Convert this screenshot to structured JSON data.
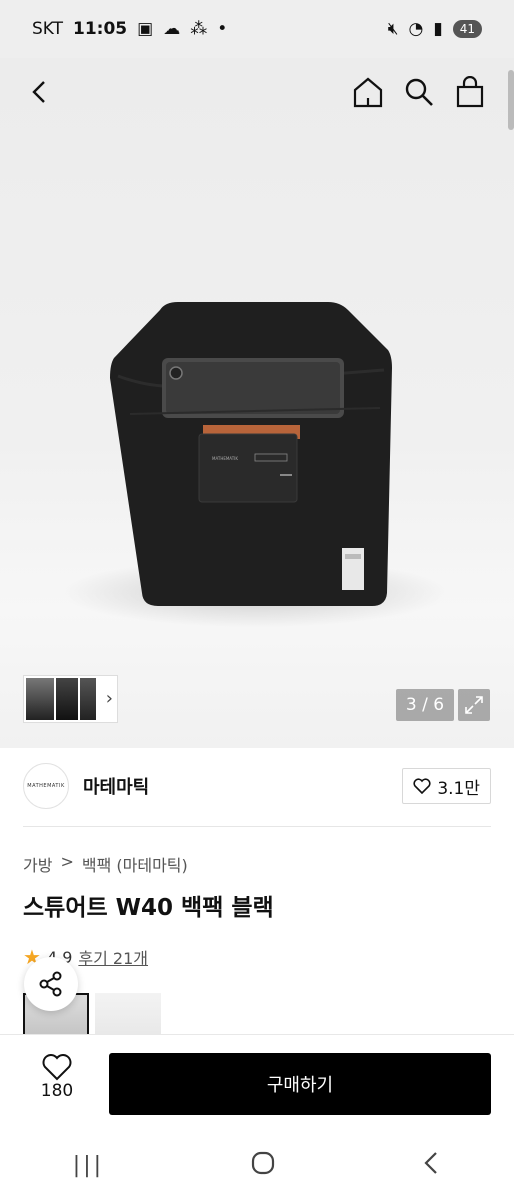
{
  "status": {
    "carrier": "SKT",
    "time": "11:05",
    "battery": "41"
  },
  "gallery": {
    "counter": "3 / 6",
    "brand_print": "MATHEMATIK"
  },
  "brand": {
    "logo_text": "MATHEMATIK",
    "name": "마테마틱",
    "likes": "3.1만"
  },
  "breadcrumb": {
    "category": "가방",
    "sep": ">",
    "subcategory": "백팩 (마테마틱)"
  },
  "product": {
    "title": "스튜어트 W40 백팩 블랙"
  },
  "rating": {
    "score": "4.9",
    "review_link": "후기 21개",
    "star_color": "#f5a623"
  },
  "bottom": {
    "fav_count": "180",
    "buy_label": "구매하기"
  },
  "icons": [
    "back-icon",
    "home-icon",
    "search-icon",
    "shopping-bag-icon",
    "chevron-right-icon",
    "expand-icon",
    "heart-icon",
    "star-icon",
    "share-icon",
    "recent-apps-icon",
    "home-button-icon",
    "back-button-icon"
  ]
}
